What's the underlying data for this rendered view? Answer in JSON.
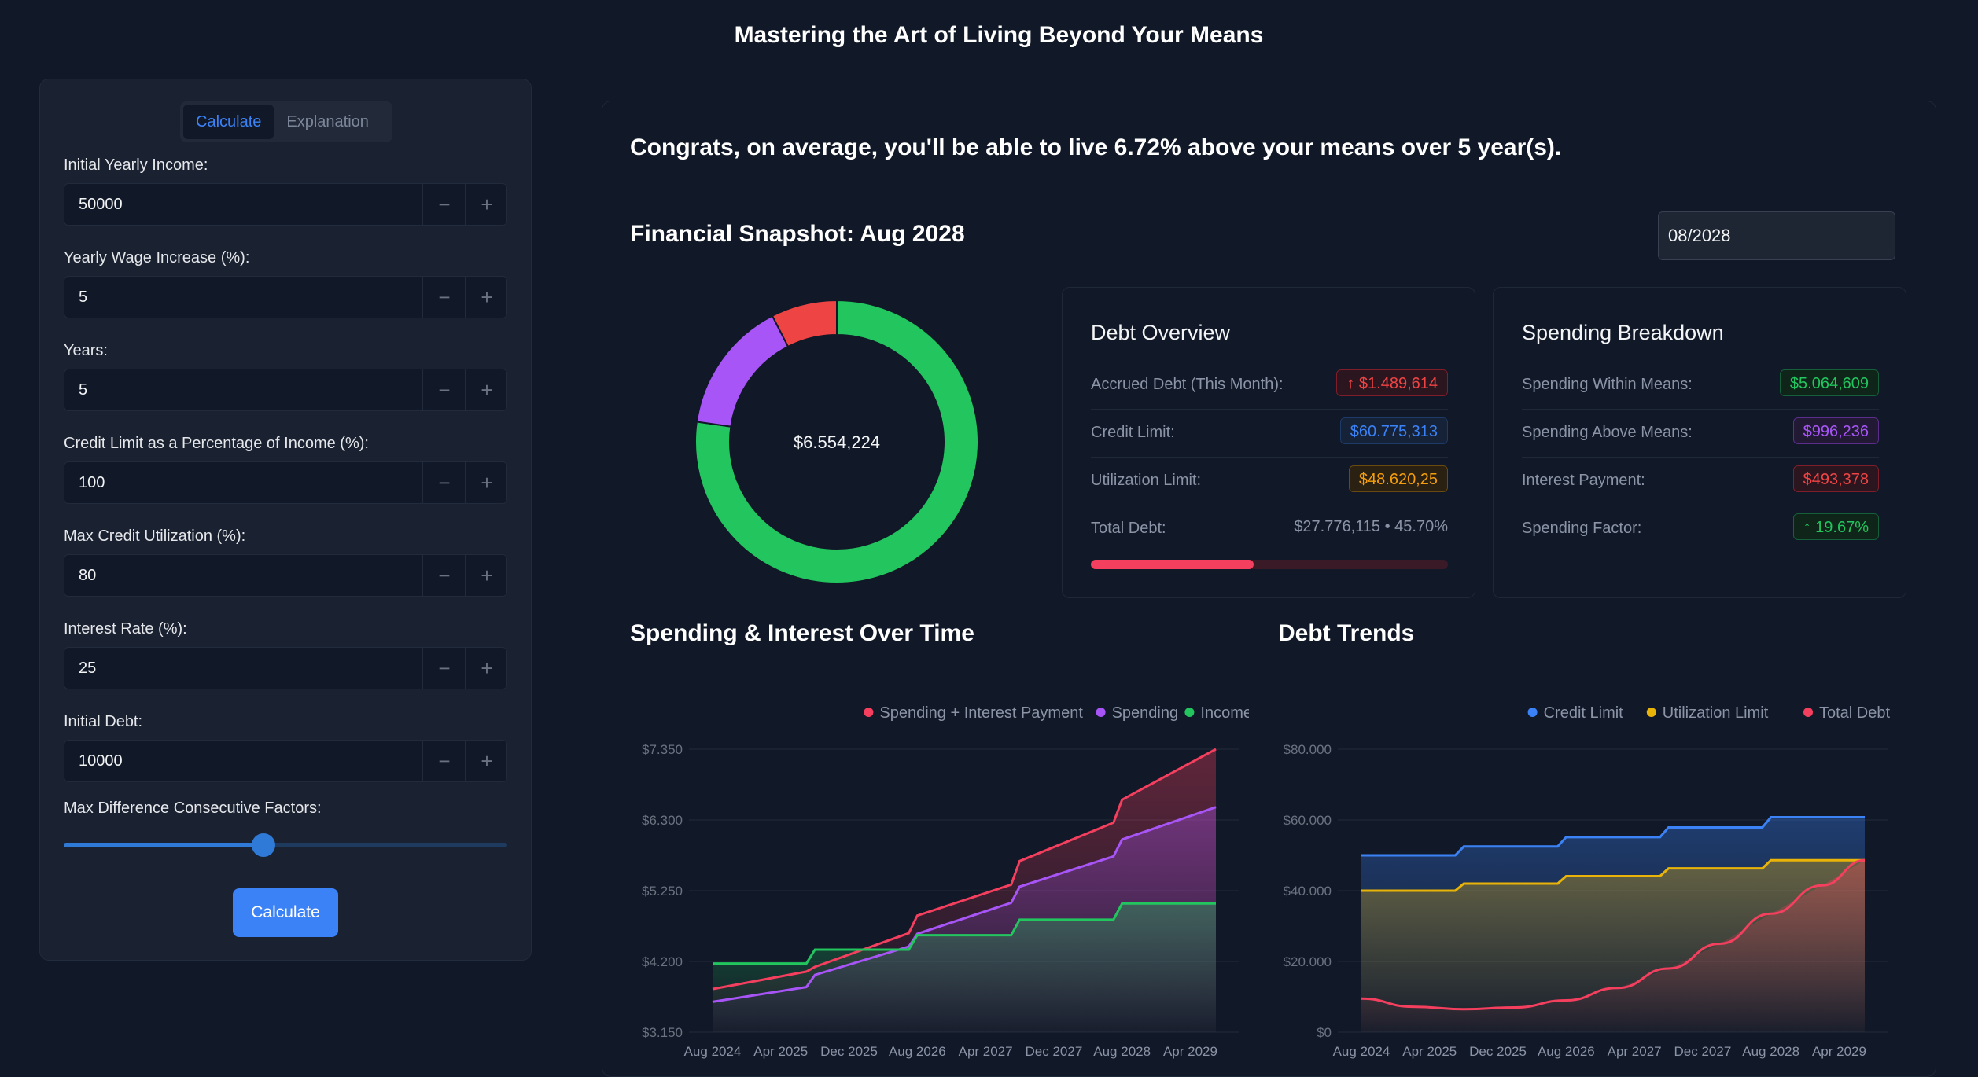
{
  "page_title": "Mastering the Art of Living Beyond Your Means",
  "sidebar": {
    "tabs": [
      {
        "label": "Calculate",
        "active": true
      },
      {
        "label": "Explanation",
        "active": false
      }
    ],
    "fields": [
      {
        "label": "Initial Yearly Income:",
        "value": "50000"
      },
      {
        "label": "Yearly Wage Increase (%):",
        "value": "5"
      },
      {
        "label": "Years:",
        "value": "5"
      },
      {
        "label": "Credit Limit as a Percentage of Income (%):",
        "value": "100"
      },
      {
        "label": "Max Credit Utilization (%):",
        "value": "80"
      },
      {
        "label": "Interest Rate (%):",
        "value": "25"
      },
      {
        "label": "Initial Debt:",
        "value": "10000"
      }
    ],
    "minus_glyph": "−",
    "plus_glyph": "+",
    "slider_label": "Max Difference Consecutive Factors:",
    "slider_level": 0.45,
    "calculate_label": "Calculate"
  },
  "main": {
    "congrats": "Congrats, on average, you'll be able to live 6.72% above your means over 5 year(s).",
    "snapshot_title": "Financial Snapshot: Aug 2028",
    "date_value": "08/2028",
    "donut": {
      "center_label": "$6.554,224",
      "slices": [
        {
          "value": 5064609,
          "color": "#22c55e"
        },
        {
          "value": 996236,
          "color": "#a855f7"
        },
        {
          "value": 493378,
          "color": "#ef4444"
        }
      ]
    },
    "debt_overview": {
      "title": "Debt Overview",
      "rows": [
        {
          "label": "Accrued Debt (This Month):",
          "value": "↑  $1.489,614",
          "style": "red"
        },
        {
          "label": "Credit Limit:",
          "value": "$60.775,313",
          "style": "blue"
        },
        {
          "label": "Utilization Limit:",
          "value": "$48.620,25",
          "style": "amber"
        },
        {
          "label": "Total Debt:",
          "value": "$27.776,115 • 45.70%",
          "style": "plain"
        }
      ],
      "progress": 0.457
    },
    "spending_breakdown": {
      "title": "Spending Breakdown",
      "rows": [
        {
          "label": "Spending Within Means:",
          "value": "$5.064,609",
          "style": "green"
        },
        {
          "label": "Spending Above Means:",
          "value": "$996,236",
          "style": "purple"
        },
        {
          "label": "Interest Payment:",
          "value": "$493,378",
          "style": "red"
        },
        {
          "label": "Spending Factor:",
          "value": "↑  19.67%",
          "style": "green"
        }
      ]
    }
  },
  "chart_data": [
    {
      "type": "area",
      "title": "Spending & Interest Over Time",
      "x_ticks": [
        "Aug 2024",
        "Apr 2025",
        "Dec 2025",
        "Aug 2026",
        "Apr 2027",
        "Dec 2027",
        "Aug 2028",
        "Apr 2029"
      ],
      "y_ticks": [
        "$3.150",
        "$4.200",
        "$5.250",
        "$6.300",
        "$7.350"
      ],
      "ylim": [
        3150,
        7350
      ],
      "x_range": [
        0,
        59
      ],
      "legend_position": "top-right",
      "series": [
        {
          "name": "Spending + Interest Payment",
          "color": "#f43f5e",
          "points": [
            [
              0,
              3790
            ],
            [
              11,
              4050
            ],
            [
              12,
              4120
            ],
            [
              23,
              4620
            ],
            [
              24,
              4880
            ],
            [
              35,
              5340
            ],
            [
              36,
              5690
            ],
            [
              47,
              6260
            ],
            [
              48,
              6600
            ],
            [
              59,
              7350
            ]
          ]
        },
        {
          "name": "Spending",
          "color": "#a855f7",
          "points": [
            [
              0,
              3600
            ],
            [
              11,
              3820
            ],
            [
              12,
              4000
            ],
            [
              23,
              4420
            ],
            [
              24,
              4610
            ],
            [
              35,
              5070
            ],
            [
              36,
              5310
            ],
            [
              47,
              5760
            ],
            [
              48,
              6010
            ],
            [
              59,
              6490
            ]
          ]
        },
        {
          "name": "Income",
          "color": "#22c55e",
          "points": [
            [
              0,
              4170
            ],
            [
              11,
              4170
            ],
            [
              12,
              4375
            ],
            [
              23,
              4375
            ],
            [
              24,
              4590
            ],
            [
              35,
              4590
            ],
            [
              36,
              4820
            ],
            [
              47,
              4820
            ],
            [
              48,
              5060
            ],
            [
              59,
              5060
            ]
          ]
        }
      ]
    },
    {
      "type": "area",
      "title": "Debt Trends",
      "x_ticks": [
        "Aug 2024",
        "Apr 2025",
        "Dec 2025",
        "Aug 2026",
        "Apr 2027",
        "Dec 2027",
        "Aug 2028",
        "Apr 2029"
      ],
      "y_ticks": [
        "$0",
        "$20.000",
        "$40.000",
        "$60.000",
        "$80.000"
      ],
      "ylim": [
        0,
        80000
      ],
      "x_range": [
        0,
        59
      ],
      "legend_position": "top-right",
      "series": [
        {
          "name": "Credit Limit",
          "color": "#3b82f6",
          "points": [
            [
              0,
              50000
            ],
            [
              11,
              50000
            ],
            [
              12,
              52500
            ],
            [
              23,
              52500
            ],
            [
              24,
              55125
            ],
            [
              35,
              55125
            ],
            [
              36,
              57881
            ],
            [
              47,
              57881
            ],
            [
              48,
              60775
            ],
            [
              59,
              60775
            ]
          ]
        },
        {
          "name": "Utilization Limit",
          "color": "#eab308",
          "points": [
            [
              0,
              40000
            ],
            [
              11,
              40000
            ],
            [
              12,
              42000
            ],
            [
              23,
              42000
            ],
            [
              24,
              44100
            ],
            [
              35,
              44100
            ],
            [
              36,
              46305
            ],
            [
              47,
              46305
            ],
            [
              48,
              48620
            ],
            [
              59,
              48620
            ]
          ]
        },
        {
          "name": "Total Debt",
          "color": "#f43f5e",
          "points": [
            [
              0,
              9500
            ],
            [
              6,
              7200
            ],
            [
              12,
              6500
            ],
            [
              18,
              7000
            ],
            [
              24,
              9000
            ],
            [
              30,
              12500
            ],
            [
              36,
              18000
            ],
            [
              42,
              25000
            ],
            [
              48,
              33500
            ],
            [
              54,
              41500
            ],
            [
              59,
              48600
            ]
          ]
        }
      ]
    }
  ]
}
